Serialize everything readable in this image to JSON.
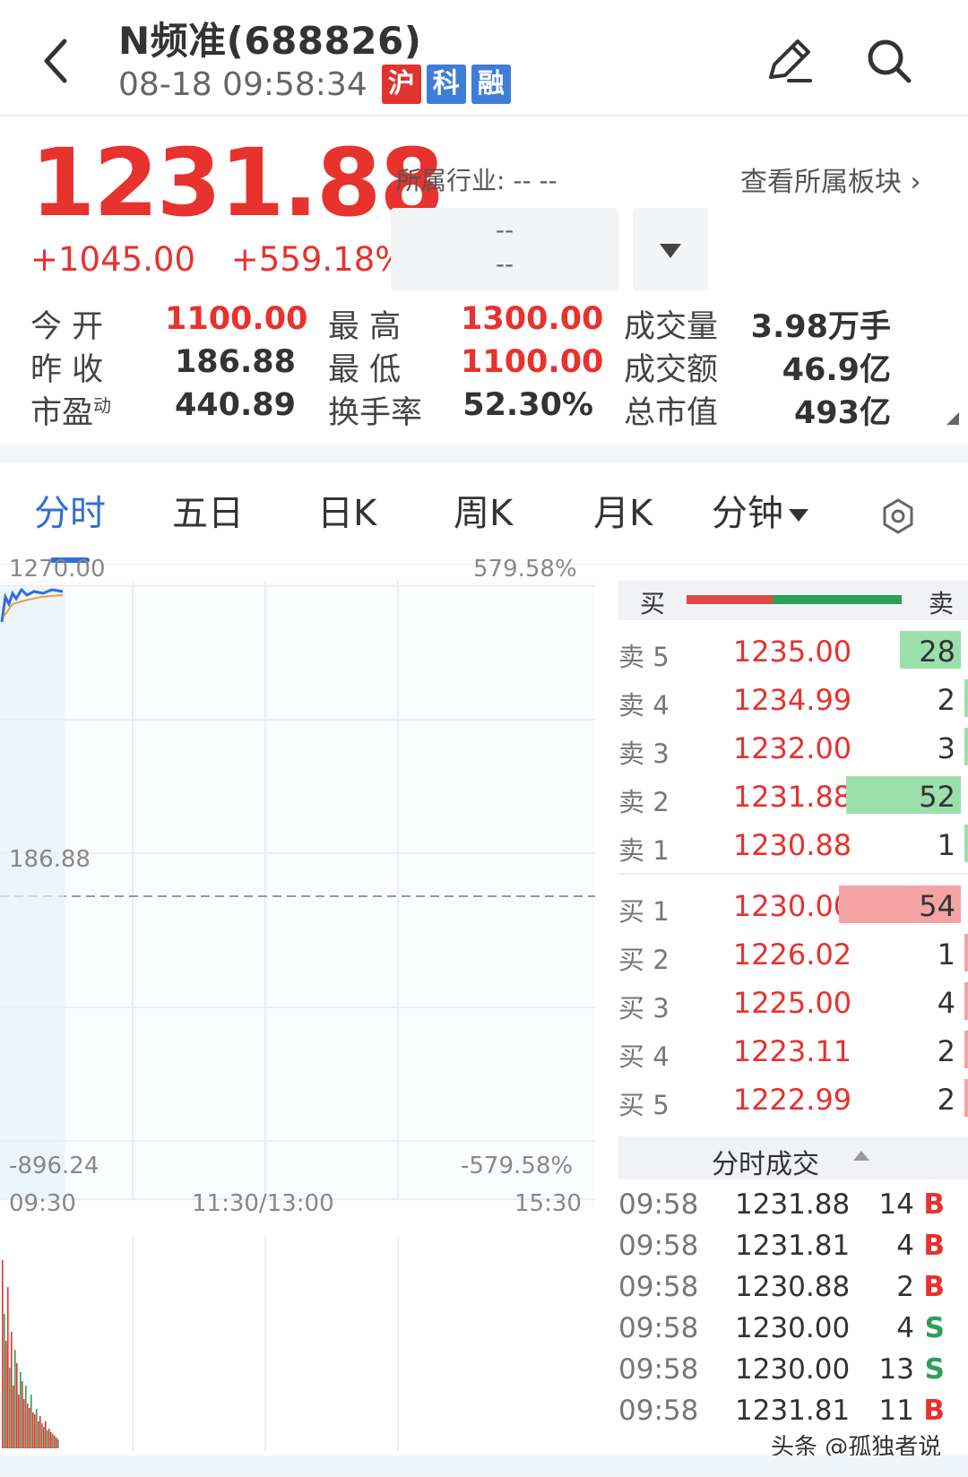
{
  "header": {
    "title": "N频准(688826)",
    "time": "08-18 09:58:34",
    "tags": [
      "沪",
      "科",
      "融"
    ]
  },
  "quote": {
    "price": "1231.88",
    "change": "+1045.00",
    "change_pct": "+559.18%",
    "industry_label": "所属行业: -- --",
    "view_sector": "查看所属板块",
    "select_top": "--",
    "select_bottom": "--"
  },
  "stats": [
    {
      "label": "今  开",
      "value": "1100.00"
    },
    {
      "label": "最  高",
      "value": "1300.00"
    },
    {
      "label": "成交量",
      "value": "3.98万手"
    },
    {
      "label": "昨  收",
      "value": "186.88"
    },
    {
      "label": "最  低",
      "value": "1100.00"
    },
    {
      "label": "成交额",
      "value": "46.9亿"
    },
    {
      "label": "市盈",
      "sup": "动",
      "value": "440.89"
    },
    {
      "label": "换手率",
      "value": "52.30%"
    },
    {
      "label": "总市值",
      "value": "493亿"
    }
  ],
  "tabs": [
    "分时",
    "五日",
    "日K",
    "周K",
    "月K",
    "分钟"
  ],
  "chart": {
    "y_top_left": "1270.00",
    "y_top_right": "579.58%",
    "y_mid_left": "186.88",
    "y_bot_left": "-896.24",
    "y_bot_right": "-579.58%",
    "x_start": "09:30",
    "x_mid": "11:30/13:00",
    "x_end": "15:30"
  },
  "orderbook": {
    "buy_label": "买",
    "sell_label": "卖",
    "buy_ratio": 0.4,
    "sells": [
      {
        "label": "卖 5",
        "price": "1235.00",
        "qty": "28"
      },
      {
        "label": "卖 4",
        "price": "1234.99",
        "qty": "2"
      },
      {
        "label": "卖 3",
        "price": "1232.00",
        "qty": "3"
      },
      {
        "label": "卖 2",
        "price": "1231.88",
        "qty": "52"
      },
      {
        "label": "卖 1",
        "price": "1230.88",
        "qty": "1"
      }
    ],
    "buys": [
      {
        "label": "买 1",
        "price": "1230.00",
        "qty": "54"
      },
      {
        "label": "买 2",
        "price": "1226.02",
        "qty": "1"
      },
      {
        "label": "买 3",
        "price": "1225.00",
        "qty": "4"
      },
      {
        "label": "买 4",
        "price": "1223.11",
        "qty": "2"
      },
      {
        "label": "买 5",
        "price": "1222.99",
        "qty": "2"
      }
    ]
  },
  "ticks": {
    "title": "分时成交",
    "rows": [
      {
        "time": "09:58",
        "price": "1231.88",
        "qty": "14",
        "side": "B"
      },
      {
        "time": "09:58",
        "price": "1231.81",
        "qty": "4",
        "side": "B"
      },
      {
        "time": "09:58",
        "price": "1230.88",
        "qty": "2",
        "side": "B"
      },
      {
        "time": "09:58",
        "price": "1230.00",
        "qty": "4",
        "side": "S"
      },
      {
        "time": "09:58",
        "price": "1230.00",
        "qty": "13",
        "side": "S"
      },
      {
        "time": "09:58",
        "price": "1231.81",
        "qty": "11",
        "side": "B"
      }
    ]
  },
  "watermark": "头条 @孤独者说",
  "colors": {
    "up": "#e8322d",
    "down": "#2aa05a",
    "accent": "#2f6fdc"
  }
}
